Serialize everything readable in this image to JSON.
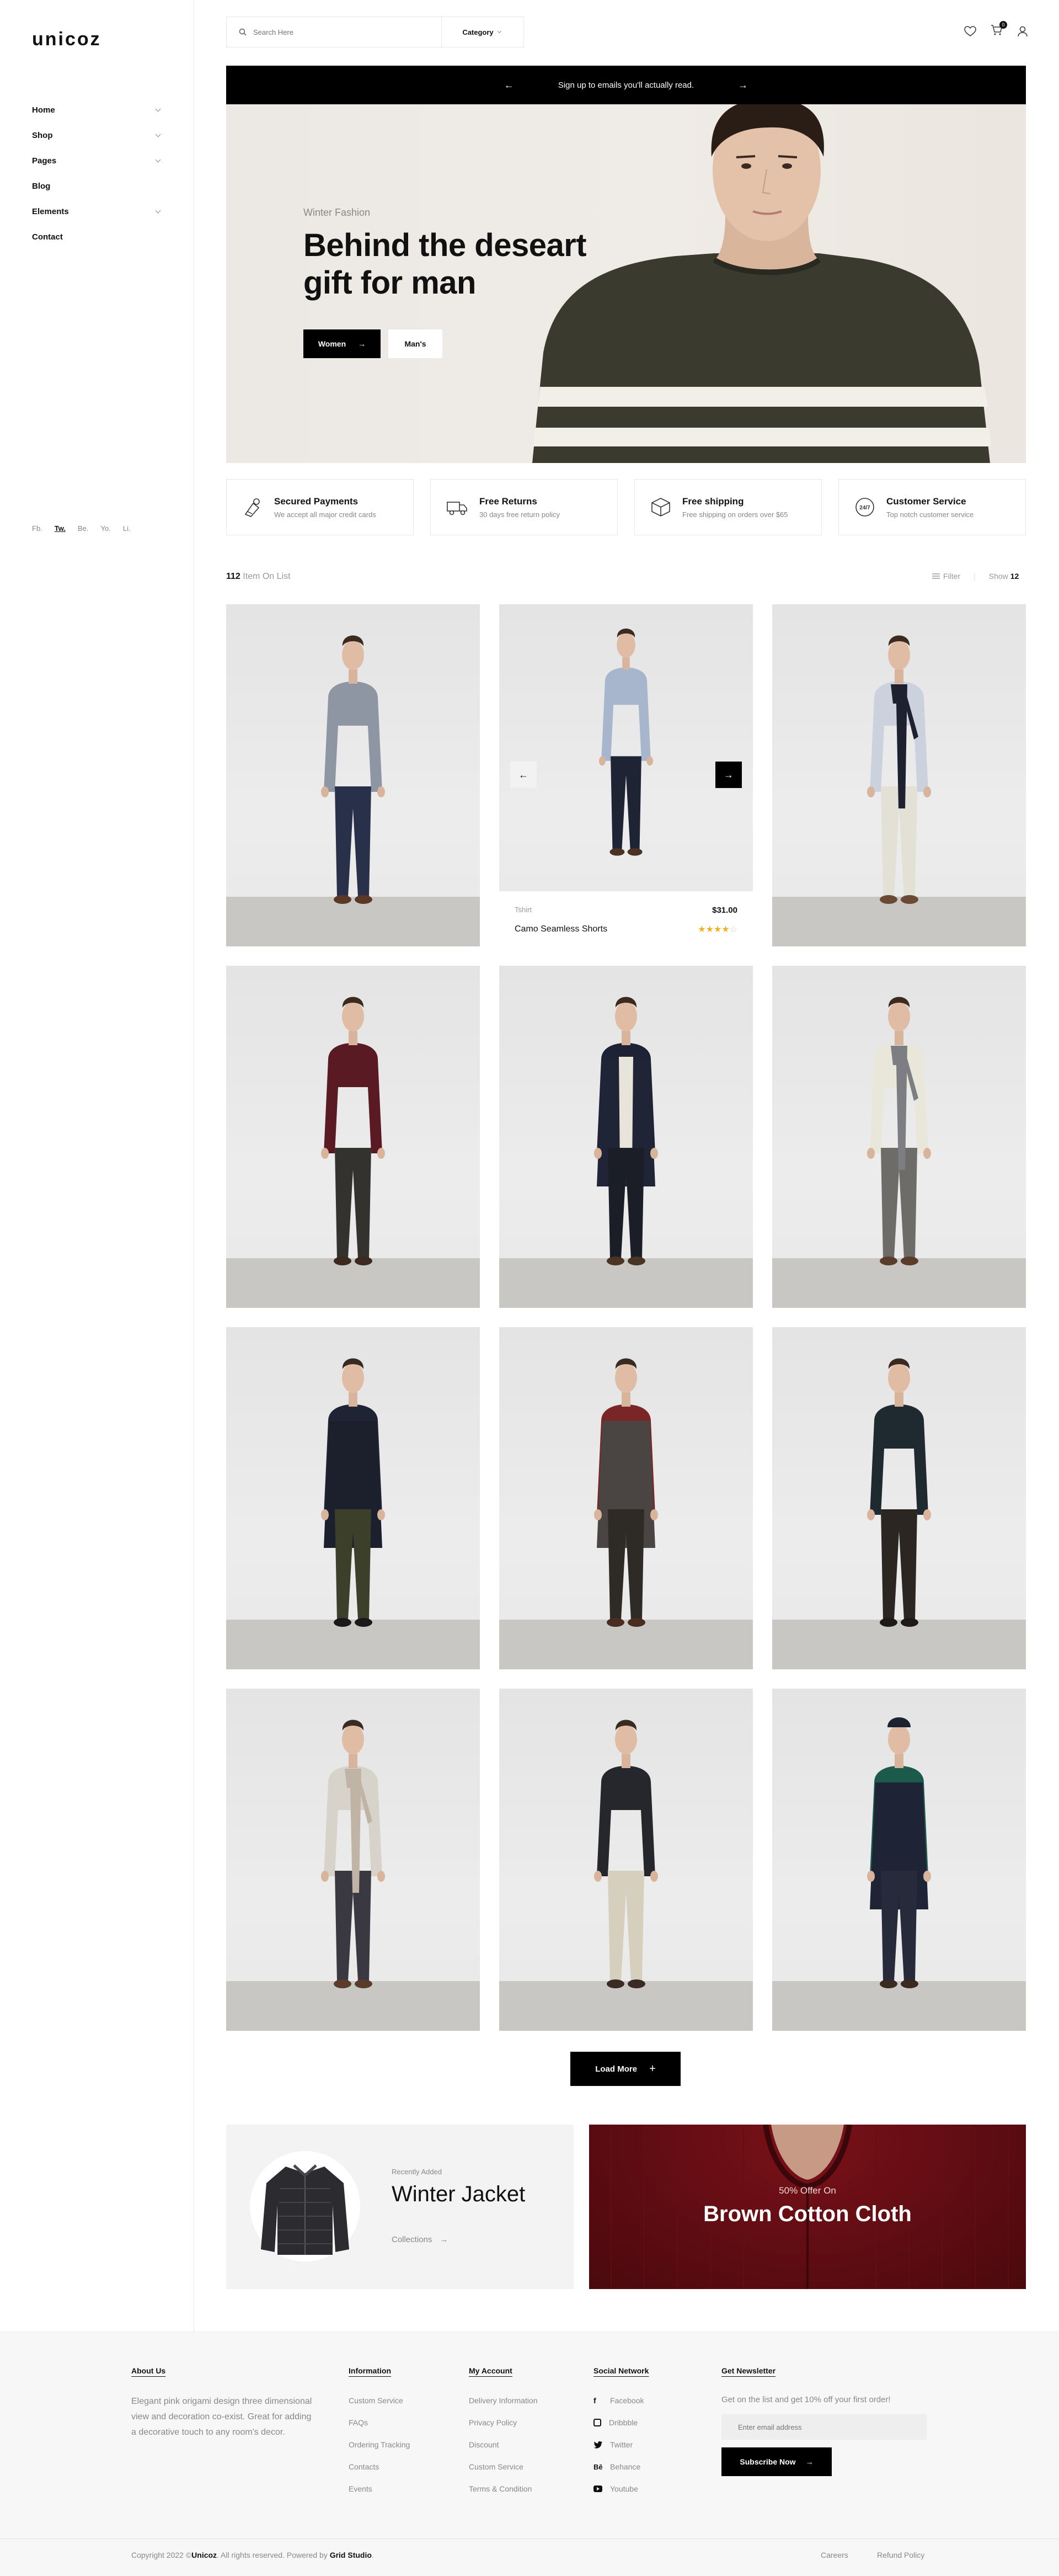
{
  "brand": {
    "logo": "unicoz"
  },
  "sidebar": {
    "nav": [
      {
        "label": "Home",
        "has_children": true
      },
      {
        "label": "Shop",
        "has_children": true
      },
      {
        "label": "Pages",
        "has_children": true
      },
      {
        "label": "Blog",
        "has_children": false
      },
      {
        "label": "Elements",
        "has_children": true
      },
      {
        "label": "Contact",
        "has_children": false
      }
    ],
    "socials": [
      "Fb.",
      "Tw.",
      "Be.",
      "Yo.",
      "Li."
    ],
    "active_social": "Tw."
  },
  "header": {
    "search_placeholder": "Search Here",
    "category_label": "Category",
    "cart_count": "0"
  },
  "promo_bar": {
    "text": "Sign up to emails you'll actually read."
  },
  "hero": {
    "subtitle": "Winter Fashion",
    "title_line1": "Behind the deseart",
    "title_line2": "gift for man",
    "btn_primary": "Women",
    "btn_secondary": "Man's"
  },
  "features": [
    {
      "title": "Secured Payments",
      "desc": "We accept all major credit cards",
      "icon": "secure-payment-icon"
    },
    {
      "title": "Free Returns",
      "desc": "30 days free return policy",
      "icon": "truck-icon"
    },
    {
      "title": "Free shipping",
      "desc": "Free shipping on orders over $65",
      "icon": "box-icon"
    },
    {
      "title": "Customer Service",
      "desc": "Top notch customer service",
      "icon": "support-24-7-icon"
    }
  ],
  "listing": {
    "count": "112",
    "count_label": "Item On List",
    "filter_label": "Filter",
    "show_label": "Show",
    "show_value": "12"
  },
  "products": [
    {
      "shirt": "#8f96a3",
      "pants": "#28304a",
      "shoes": "#5a3828"
    },
    {
      "shirt": "#a7b6cc",
      "pants": "#1f2434",
      "shoes": "#4a3324",
      "hover": true,
      "category": "Tshirt",
      "price": "$31.00",
      "name": "Camo Seamless Shorts",
      "rating": 4
    },
    {
      "shirt": "#cbd2de",
      "pants": "#e3e0d6",
      "shoes": "#6a4a34",
      "scarf": "#1e2230"
    },
    {
      "shirt": "#5a1a24",
      "pants": "#34322f",
      "shoes": "#3c2a20"
    },
    {
      "shirt": "#1d2334",
      "pants": "#1b1d27",
      "shoes": "#4a3424",
      "coat": "#1f2536",
      "inner": "#e8e4da"
    },
    {
      "shirt": "#e9e6da",
      "pants": "#6e6c69",
      "shoes": "#5a3c2a",
      "scarf": "#7c7e84"
    },
    {
      "shirt": "#1f2434",
      "pants": "#3c3f2a",
      "shoes": "#1a1a1a",
      "coat": "#1b202c"
    },
    {
      "shirt": "#7a2526",
      "pants": "#2e2a26",
      "shoes": "#4a2c20",
      "coat": "#4a4442"
    },
    {
      "shirt": "#1f2a30",
      "pants": "#2c2622",
      "shoes": "#1f1a18"
    },
    {
      "shirt": "#d7d2ca",
      "pants": "#3a3840",
      "shoes": "#5a3c2c",
      "scarf": "#bfb4a6"
    },
    {
      "shirt": "#25272c",
      "pants": "#d6cfbe",
      "shoes": "#3a2c24"
    },
    {
      "shirt": "#1c5a4c",
      "pants": "#262a3a",
      "shoes": "#3a2a22",
      "coat": "#1e2336",
      "hat": true
    }
  ],
  "load_more": "Load More",
  "banner_left": {
    "eyebrow": "Recently Added",
    "title": "Winter Jacket",
    "link": "Collections"
  },
  "banner_right": {
    "eyebrow": "50% Offer On",
    "title": "Brown Cotton Cloth"
  },
  "footer": {
    "about": {
      "heading": "About Us",
      "text": "Elegant pink origami design three dimensional view and decoration co-exist. Great for adding a decorative touch to any room's decor."
    },
    "information": {
      "heading": "Information",
      "links": [
        "Custom Service",
        "FAQs",
        "Ordering Tracking",
        "Contacts",
        "Events"
      ]
    },
    "account": {
      "heading": "My Account",
      "links": [
        "Delivery Information",
        "Privacy Policy",
        "Discount",
        "Custom Service",
        "Terms & Condition"
      ]
    },
    "social": {
      "heading": "Social Network",
      "links": [
        {
          "label": "Facebook",
          "icon": "facebook-icon"
        },
        {
          "label": "Dribbble",
          "icon": "dribbble-icon"
        },
        {
          "label": "Twitter",
          "icon": "twitter-icon"
        },
        {
          "label": "Behance",
          "icon": "behance-icon"
        },
        {
          "label": "Youtube",
          "icon": "youtube-icon"
        }
      ]
    },
    "newsletter": {
      "heading": "Get Newsletter",
      "text": "Get on the list and get 10% off your first order!",
      "placeholder": "Enter email address",
      "button": "Subscribe Now"
    },
    "copyright_prefix": "Copyright 2022 ©",
    "copyright_brand": "Unicoz",
    "copyright_middle": ". All rights reserved. Powered by ",
    "copyright_studio": "Grid Studio",
    "copyright_suffix": ".",
    "bottom_links": [
      "Careers",
      "Refund Policy"
    ]
  }
}
